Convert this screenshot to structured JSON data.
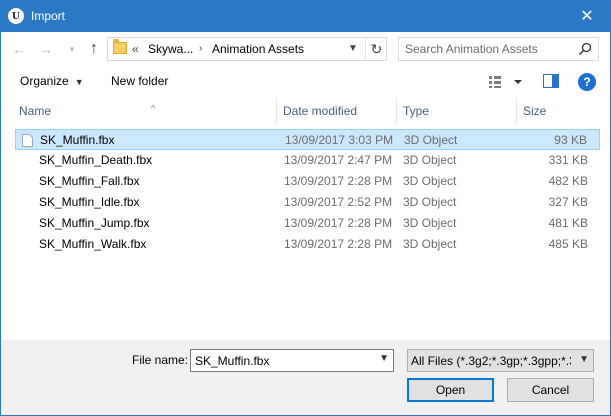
{
  "window": {
    "title": "Import",
    "app_icon_letter": "U",
    "close_glyph": "✕"
  },
  "address": {
    "overflow": "«",
    "crumbs": [
      "Skywa...",
      "Animation Assets"
    ],
    "separator": "›"
  },
  "search": {
    "placeholder": "Search Animation Assets"
  },
  "toolbar": {
    "organize_label": "Organize",
    "new_folder_label": "New folder",
    "help_label": "?"
  },
  "columns": {
    "name": "Name",
    "date": "Date modified",
    "type": "Type",
    "size": "Size"
  },
  "files": [
    {
      "name": "SK_Muffin.fbx",
      "date": "13/09/2017 3:03 PM",
      "type": "3D Object",
      "size": "93 KB",
      "selected": true
    },
    {
      "name": "SK_Muffin_Death.fbx",
      "date": "13/09/2017 2:47 PM",
      "type": "3D Object",
      "size": "331 KB",
      "selected": false
    },
    {
      "name": "SK_Muffin_Fall.fbx",
      "date": "13/09/2017 2:28 PM",
      "type": "3D Object",
      "size": "482 KB",
      "selected": false
    },
    {
      "name": "SK_Muffin_Idle.fbx",
      "date": "13/09/2017 2:52 PM",
      "type": "3D Object",
      "size": "327 KB",
      "selected": false
    },
    {
      "name": "SK_Muffin_Jump.fbx",
      "date": "13/09/2017 2:28 PM",
      "type": "3D Object",
      "size": "481 KB",
      "selected": false
    },
    {
      "name": "SK_Muffin_Walk.fbx",
      "date": "13/09/2017 2:28 PM",
      "type": "3D Object",
      "size": "485 KB",
      "selected": false
    }
  ],
  "bottom": {
    "file_name_label": "File name:",
    "file_name_value": "SK_Muffin.fbx",
    "filter_value": "All Files (*.3g2;*.3gp;*.3gpp;*.3g",
    "open_label": "Open",
    "cancel_label": "Cancel"
  },
  "colors": {
    "titlebar": "#2b78c5",
    "selection": "#cce8ff",
    "accent": "#0078d7"
  }
}
